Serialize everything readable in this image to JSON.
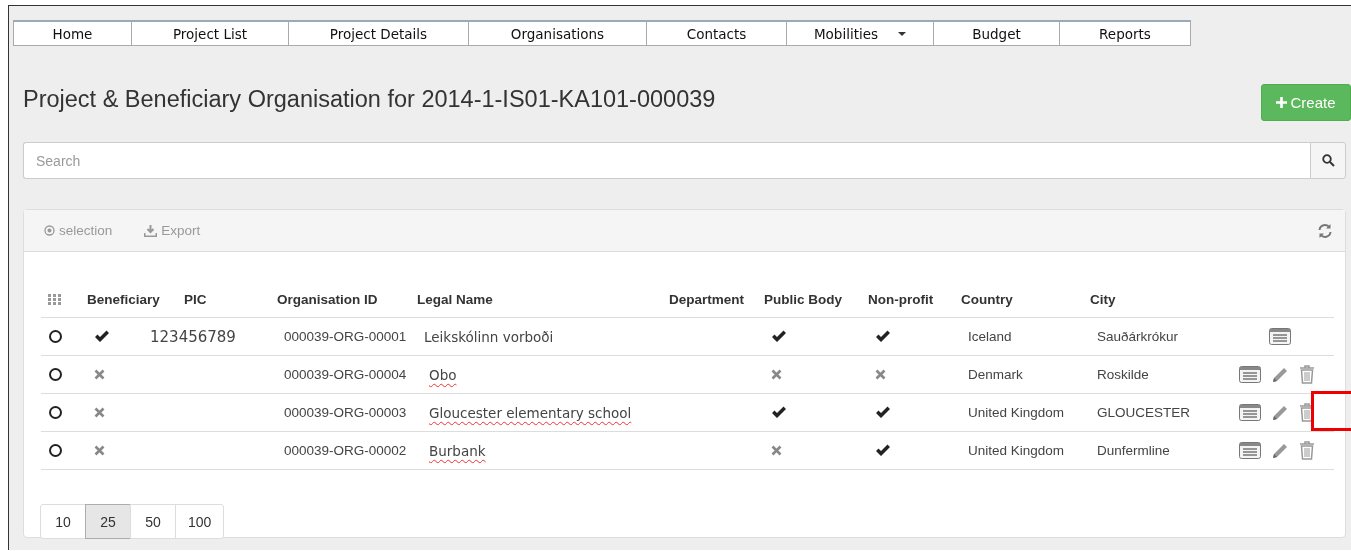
{
  "nav_tabs": [
    {
      "label": "Home",
      "dropdown": false
    },
    {
      "label": "Project List",
      "dropdown": false
    },
    {
      "label": "Project Details",
      "dropdown": false
    },
    {
      "label": "Organisations",
      "dropdown": false
    },
    {
      "label": "Contacts",
      "dropdown": false
    },
    {
      "label": "Mobilities",
      "dropdown": true
    },
    {
      "label": "Budget",
      "dropdown": false
    },
    {
      "label": "Reports",
      "dropdown": false
    }
  ],
  "page_title": "Project & Beneficiary Organisation for 2014-1-IS01-KA101-000039",
  "create_button": "Create",
  "search": {
    "placeholder": "Search"
  },
  "toolbar": {
    "selection": "selection",
    "export": "Export"
  },
  "table": {
    "columns": [
      "Beneficiary",
      "PIC",
      "Organisation ID",
      "Legal Name",
      "Department",
      "Public Body",
      "Non-profit",
      "Country",
      "City"
    ],
    "rows": [
      {
        "selected": false,
        "beneficiary": true,
        "pic": "123456789",
        "organisation_id": "000039-ORG-00001",
        "legal_name": "Leikskólinn vorboði",
        "spelling_error": false,
        "public_body": true,
        "non_profit": true,
        "country": "Iceland",
        "city": "Sauðárkrókur",
        "view": true,
        "edit": false,
        "delete": false,
        "highlighted": false
      },
      {
        "selected": false,
        "beneficiary": false,
        "organisation_id": "000039-ORG-00004",
        "legal_name": "Obo",
        "spelling_error": true,
        "public_body": false,
        "non_profit": false,
        "country": "Denmark",
        "city": "Roskilde",
        "view": true,
        "edit": true,
        "delete": true,
        "highlighted": false
      },
      {
        "selected": false,
        "beneficiary": false,
        "organisation_id": "000039-ORG-00003",
        "legal_name": "Gloucester elementary school",
        "spelling_error": true,
        "public_body": true,
        "non_profit": true,
        "country": "United Kingdom",
        "city": "GLOUCESTER",
        "view": true,
        "edit": true,
        "delete": true,
        "highlighted": true
      },
      {
        "selected": false,
        "beneficiary": false,
        "organisation_id": "000039-ORG-00002",
        "legal_name": "Burbank",
        "spelling_error": true,
        "public_body": false,
        "non_profit": true,
        "country": "United Kingdom",
        "city": "Dunfermline",
        "view": true,
        "edit": true,
        "delete": true,
        "highlighted": false
      }
    ]
  },
  "page_sizes": [
    {
      "label": "10",
      "selected": false
    },
    {
      "label": "25",
      "selected": true
    },
    {
      "label": "50",
      "selected": false
    },
    {
      "label": "100",
      "selected": false
    }
  ]
}
